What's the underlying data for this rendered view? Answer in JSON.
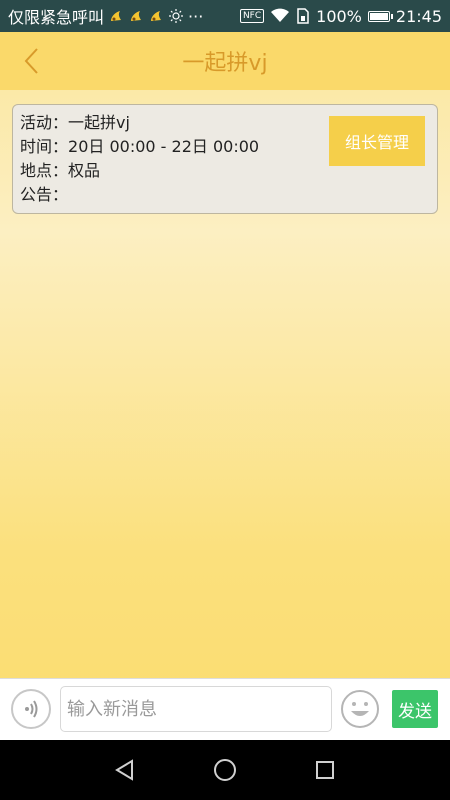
{
  "status_bar": {
    "carrier": "仅限紧急呼叫",
    "battery_percent": "100%",
    "time": "21:45",
    "nfc": "NFC",
    "more": "···"
  },
  "header": {
    "title": "一起拼vj"
  },
  "info": {
    "activity_label": "活动：",
    "activity_value": "一起拼vj",
    "time_label": "时间：",
    "time_value": "20日 00:00 - 22日 00:00",
    "location_label": "地点：",
    "location_value": "权品",
    "notice_label": "公告：",
    "notice_value": "",
    "leader_button": "组长管理"
  },
  "input_bar": {
    "placeholder": "输入新消息",
    "value": "",
    "send_label": "发送"
  },
  "colors": {
    "title": "#d89a2a",
    "accent": "#f5cf4a",
    "send": "#3cc56a",
    "header_bg": "#fad96a"
  },
  "icons": {
    "back": "chevron-left-icon",
    "voice": "voice-icon",
    "emoji": "smiley-icon",
    "nav_back": "triangle-back-icon",
    "nav_home": "circle-home-icon",
    "nav_recent": "square-recent-icon"
  }
}
